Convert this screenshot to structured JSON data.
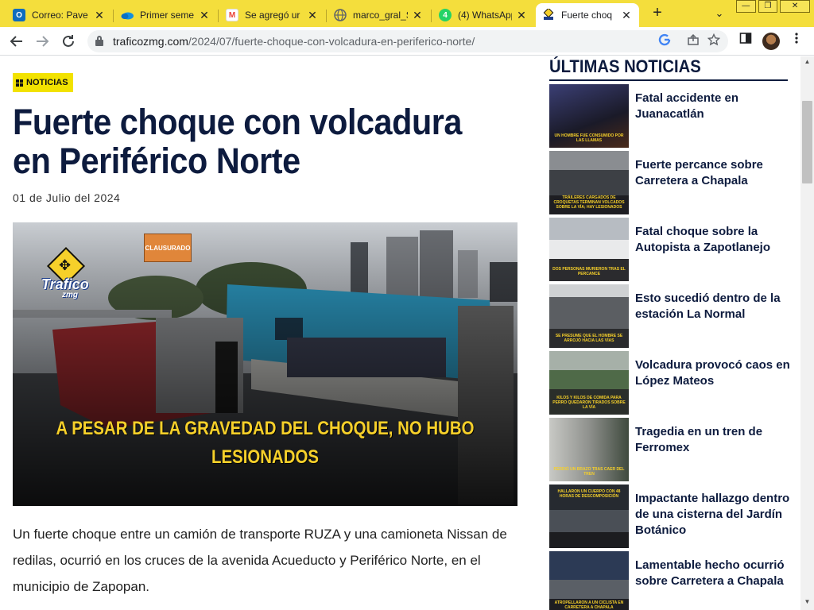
{
  "browser": {
    "tabs": [
      {
        "title": "Correo: Pave",
        "favicon": "outlook-icon",
        "color": "#0f6cbd",
        "glyph": "O"
      },
      {
        "title": "Primer seme",
        "favicon": "onedrive-icon",
        "color": "#1490df",
        "glyph": ""
      },
      {
        "title": "Se agregó ur",
        "favicon": "gmail-icon",
        "color": "#ea4335",
        "glyph": "M"
      },
      {
        "title": "marco_gral_S",
        "favicon": "globe-icon",
        "color": "#5f6368",
        "glyph": ""
      },
      {
        "title": "(4) WhatsApp",
        "favicon": "whatsapp-icon",
        "color": "#25d366",
        "glyph": "4"
      },
      {
        "title": "Fuerte choq",
        "favicon": "traficozmg-icon",
        "color": "#f6d02a",
        "glyph": ""
      }
    ],
    "new_tab": "+",
    "tab_menu": "⌄",
    "window_buttons": {
      "minimize": "—",
      "restore": "❐",
      "close": "✕"
    },
    "url_host": "traficozmg.com",
    "url_path": "/2024/07/fuerte-choque-con-volcadura-en-periferico-norte/"
  },
  "article": {
    "category": "NOTICIAS",
    "title": "Fuerte choque con volcadura en Periférico Norte",
    "date": "01 de Julio del 2024",
    "hero_caption": "A PESAR DE LA GRAVEDAD DEL CHOQUE, NO HUBO LESIONADOS",
    "hero_logo_word": "Trafico",
    "hero_logo_sub": "zmg",
    "hero_sign": "CLAUSURADO",
    "paragraph": "Un fuerte choque entre un camión de transporte RUZA y una camioneta Nissan de redilas, ocurrió en los cruces de la avenida Acueducto y Periférico Norte, en el municipio de Zapopan."
  },
  "sidebar": {
    "title": "ÚLTIMAS NOTICIAS",
    "items": [
      {
        "headline": "Fatal accidente en Juanacatlán",
        "thumb_caption": "UN HOMBRE FUE CONSUMIDO POR LAS LLAMAS",
        "bg": "#2a2a4a"
      },
      {
        "headline": "Fuerte percance sobre Carretera a Chapala",
        "thumb_caption": "TRÁILERES CARGADOS DE CROQUETAS TERMINAN VOLCADOS SOBRE LA VÍA; HAY LESIONADOS",
        "bg": "#56595e"
      },
      {
        "headline": "Fatal choque sobre la Autopista a Zapotlanejo",
        "thumb_caption": "DOS PERSONAS MURIERON TRAS EL PERCANCE",
        "bg": "#8a8f96"
      },
      {
        "headline": "Esto sucedió dentro de la estación La Normal",
        "thumb_caption": "SE PRESUME QUE EL HOMBRE SE ARROJÓ HACIA LAS VÍAS",
        "bg": "#6c6f72"
      },
      {
        "headline": "Volcadura provocó caos en López Mateos",
        "thumb_caption": "KILOS Y KILOS DE COMIDA PARA PERRO QUEDARON TIRADOS SOBRE LA VÍA",
        "bg": "#5b6a54"
      },
      {
        "headline": "Tragedia en un tren de Ferromex",
        "thumb_caption": "PERDIÓ UN BRAZO TRAS CAER DEL TREN",
        "bg": "#9a9c98"
      },
      {
        "headline": "Impactante hallazgo dentro de una cisterna del Jardín Botánico",
        "thumb_caption": "HALLARON UN CUERPO CON 48 HORAS DE DESCOMPOSICIÓN",
        "bg": "#3c4048"
      },
      {
        "headline": "Lamentable hecho ocurrió sobre Carretera a Chapala",
        "thumb_caption": "ATROPELLARON A UN CICLISTA EN CARRETERA A CHAPALA",
        "bg": "#2f3a52"
      }
    ]
  },
  "colors": {
    "tabstrip": "#f4de3c",
    "navy": "#0d1b3e",
    "badge": "#f2e200",
    "caption_yellow": "#f6d02a"
  }
}
